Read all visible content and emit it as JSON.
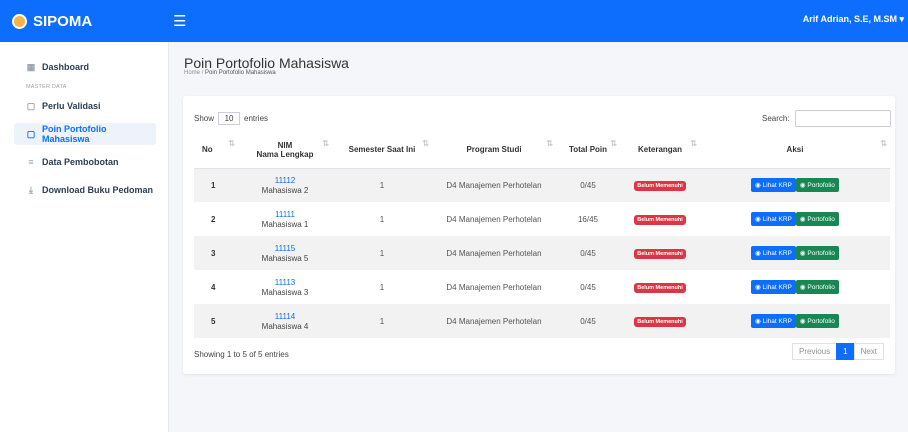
{
  "brand": "SIPOMA",
  "user": "Arif Adrian, S.E, M.SM ▾",
  "sidebar": {
    "items": [
      {
        "label": "Dashboard",
        "icon": "grid-icon"
      },
      {
        "label": "Perlu Validasi",
        "icon": "clipboard-icon"
      },
      {
        "label": "Poin Portofolio Mahasiswa",
        "icon": "clipboard-icon"
      },
      {
        "label": "Data Pembobotan",
        "icon": "list-icon"
      },
      {
        "label": "Download Buku Pedoman",
        "icon": "download-icon"
      }
    ],
    "section": "MASTER DATA"
  },
  "page": {
    "title": "Poin Portofolio Mahasiswa",
    "breadcrumb_home": "Home",
    "breadcrumb_current": "Poin Portofolio Mahasiswa"
  },
  "table_controls": {
    "show": "Show",
    "entries_value": "10",
    "entries": "entries",
    "search_label": "Search:",
    "search_value": ""
  },
  "table": {
    "headers": {
      "no": "No",
      "nim": "NIM",
      "nama": "Nama Lengkap",
      "semester": "Semester Saat Ini",
      "prodi": "Program Studi",
      "total": "Total Poin",
      "ket": "Keterangan",
      "aksi": "Aksi"
    },
    "rows": [
      {
        "no": "1",
        "nim": "11112",
        "nama": "Mahasiswa 2",
        "semester": "1",
        "prodi": "D4 Manajemen Perhotelan",
        "total": "0/45",
        "ket": "Belum Memenuhi",
        "krp": "Lihat KRP",
        "porto": "Portofolio"
      },
      {
        "no": "2",
        "nim": "11111",
        "nama": "Mahasiswa 1",
        "semester": "1",
        "prodi": "D4 Manajemen Perhotelan",
        "total": "16/45",
        "ket": "Belum Memenuhi",
        "krp": "Lihat KRP",
        "porto": "Portofolio"
      },
      {
        "no": "3",
        "nim": "11115",
        "nama": "Mahasiswa 5",
        "semester": "1",
        "prodi": "D4 Manajemen Perhotelan",
        "total": "0/45",
        "ket": "Belum Memenuhi",
        "krp": "Lihat KRP",
        "porto": "Portofolio"
      },
      {
        "no": "4",
        "nim": "11113",
        "nama": "Mahasiswa 3",
        "semester": "1",
        "prodi": "D4 Manajemen Perhotelan",
        "total": "0/45",
        "ket": "Belum Memenuhi",
        "krp": "Lihat KRP",
        "porto": "Portofolio"
      },
      {
        "no": "5",
        "nim": "11114",
        "nama": "Mahasiswa 4",
        "semester": "1",
        "prodi": "D4 Manajemen Perhotelan",
        "total": "0/45",
        "ket": "Belum Memenuhi",
        "krp": "Lihat KRP",
        "porto": "Portofolio"
      }
    ]
  },
  "footer": {
    "showing": "Showing 1 to 5 of 5 entries",
    "previous": "Previous",
    "page": "1",
    "next": "Next"
  },
  "colors": {
    "primary": "#0d6efd",
    "danger": "#dc3545",
    "success": "#198754"
  }
}
